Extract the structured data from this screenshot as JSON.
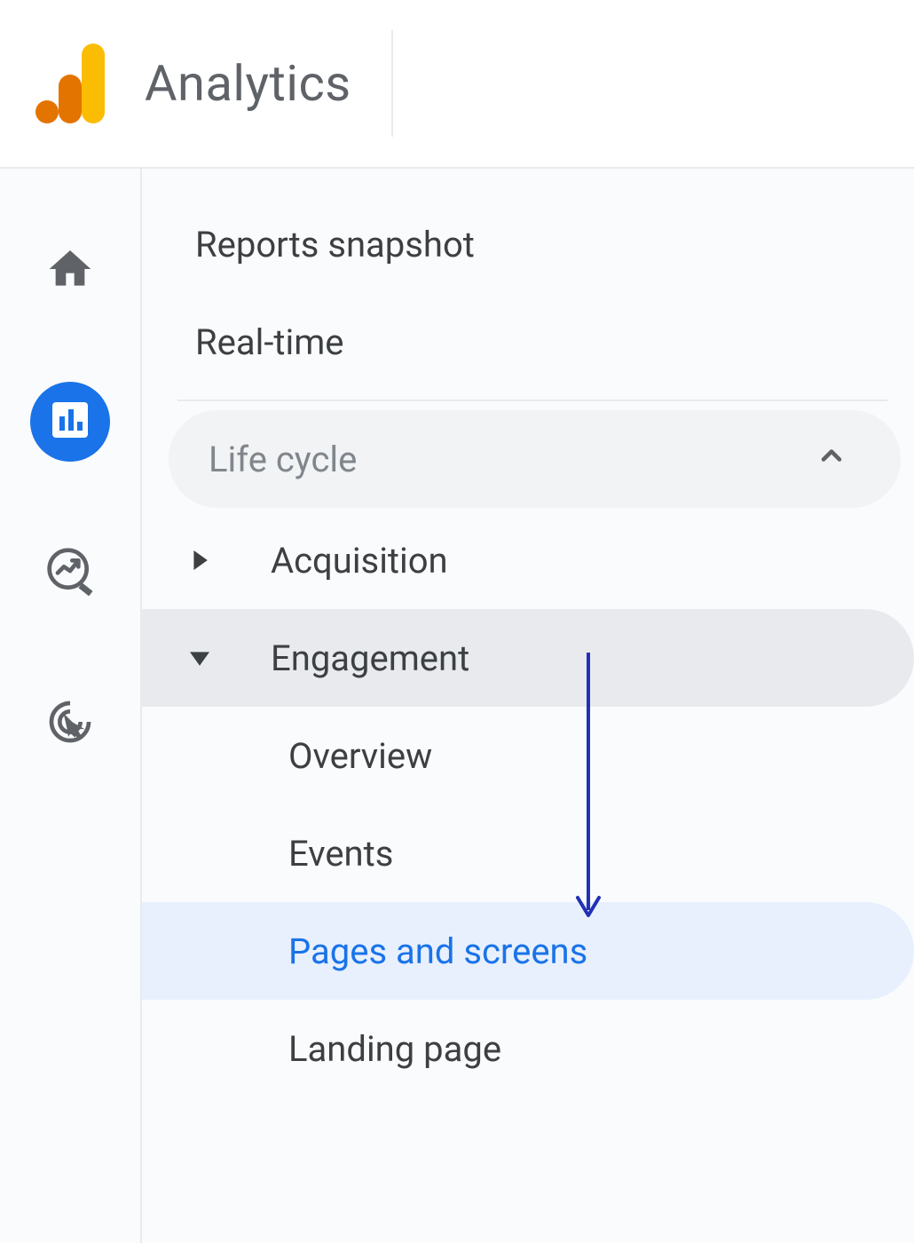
{
  "header": {
    "title": "Analytics"
  },
  "rail": {
    "items": [
      {
        "name": "home",
        "active": false
      },
      {
        "name": "reports",
        "active": true
      },
      {
        "name": "explore",
        "active": false
      },
      {
        "name": "advertising",
        "active": false
      }
    ]
  },
  "nav": {
    "top": [
      {
        "label": "Reports snapshot"
      },
      {
        "label": "Real-time"
      }
    ],
    "section": {
      "label": "Life cycle",
      "expanded": true,
      "groups": [
        {
          "label": "Acquisition",
          "expanded": false
        },
        {
          "label": "Engagement",
          "expanded": true,
          "items": [
            {
              "label": "Overview",
              "selected": false
            },
            {
              "label": "Events",
              "selected": false
            },
            {
              "label": "Pages and screens",
              "selected": true
            },
            {
              "label": "Landing page",
              "selected": false
            }
          ]
        }
      ]
    }
  },
  "colors": {
    "brand_orange_dark": "#e37400",
    "brand_orange_light": "#fbbc04",
    "primary_blue": "#1a73e8",
    "annotation": "#2331b5"
  }
}
